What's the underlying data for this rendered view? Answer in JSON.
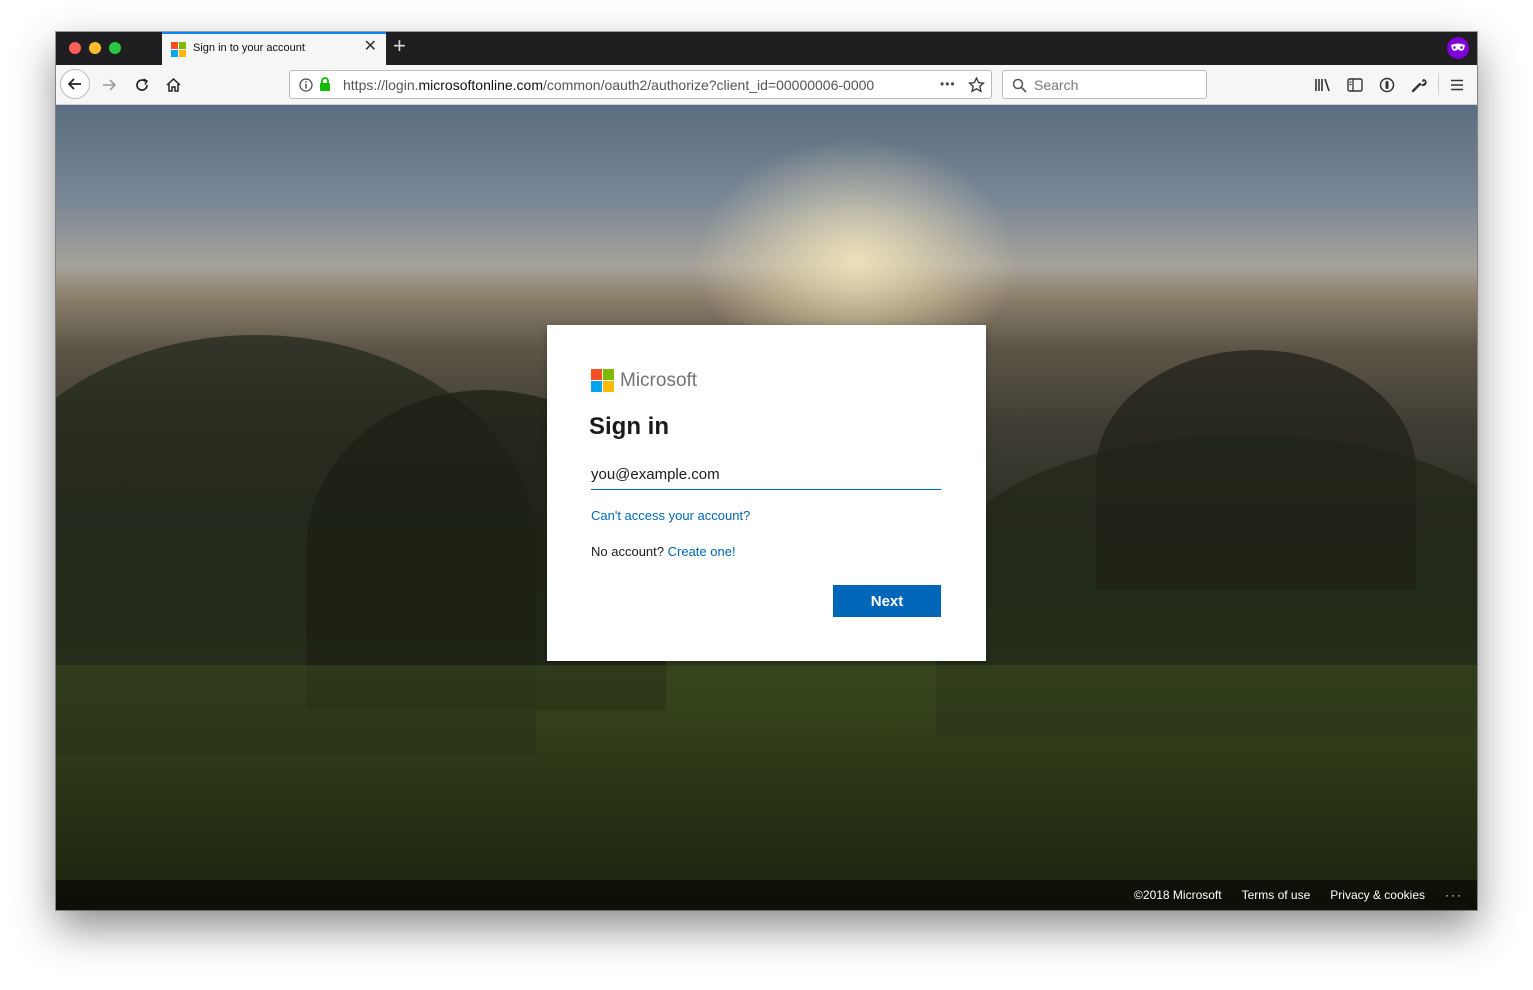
{
  "browser": {
    "tab_title": "Sign in to your account",
    "url_prefix": "https://login.",
    "url_domain": "microsoftonline.com",
    "url_path": "/common/oauth2/authorize?client_id=00000006-0000",
    "search_placeholder": "Search",
    "tab_close": "✕",
    "new_tab": "+",
    "menu_dots": "•••"
  },
  "signin": {
    "brand": "Microsoft",
    "title": "Sign in",
    "email_value": "you@example.com",
    "cant_access": "Can't access your account?",
    "no_account": "No account?",
    "create_one": "Create one!",
    "next_label": "Next"
  },
  "footer": {
    "copyright": "©2018 Microsoft",
    "terms": "Terms of use",
    "privacy": "Privacy & cookies",
    "more": "···"
  },
  "colors": {
    "accent": "#0067b8",
    "private_badge": "#8000d7"
  }
}
